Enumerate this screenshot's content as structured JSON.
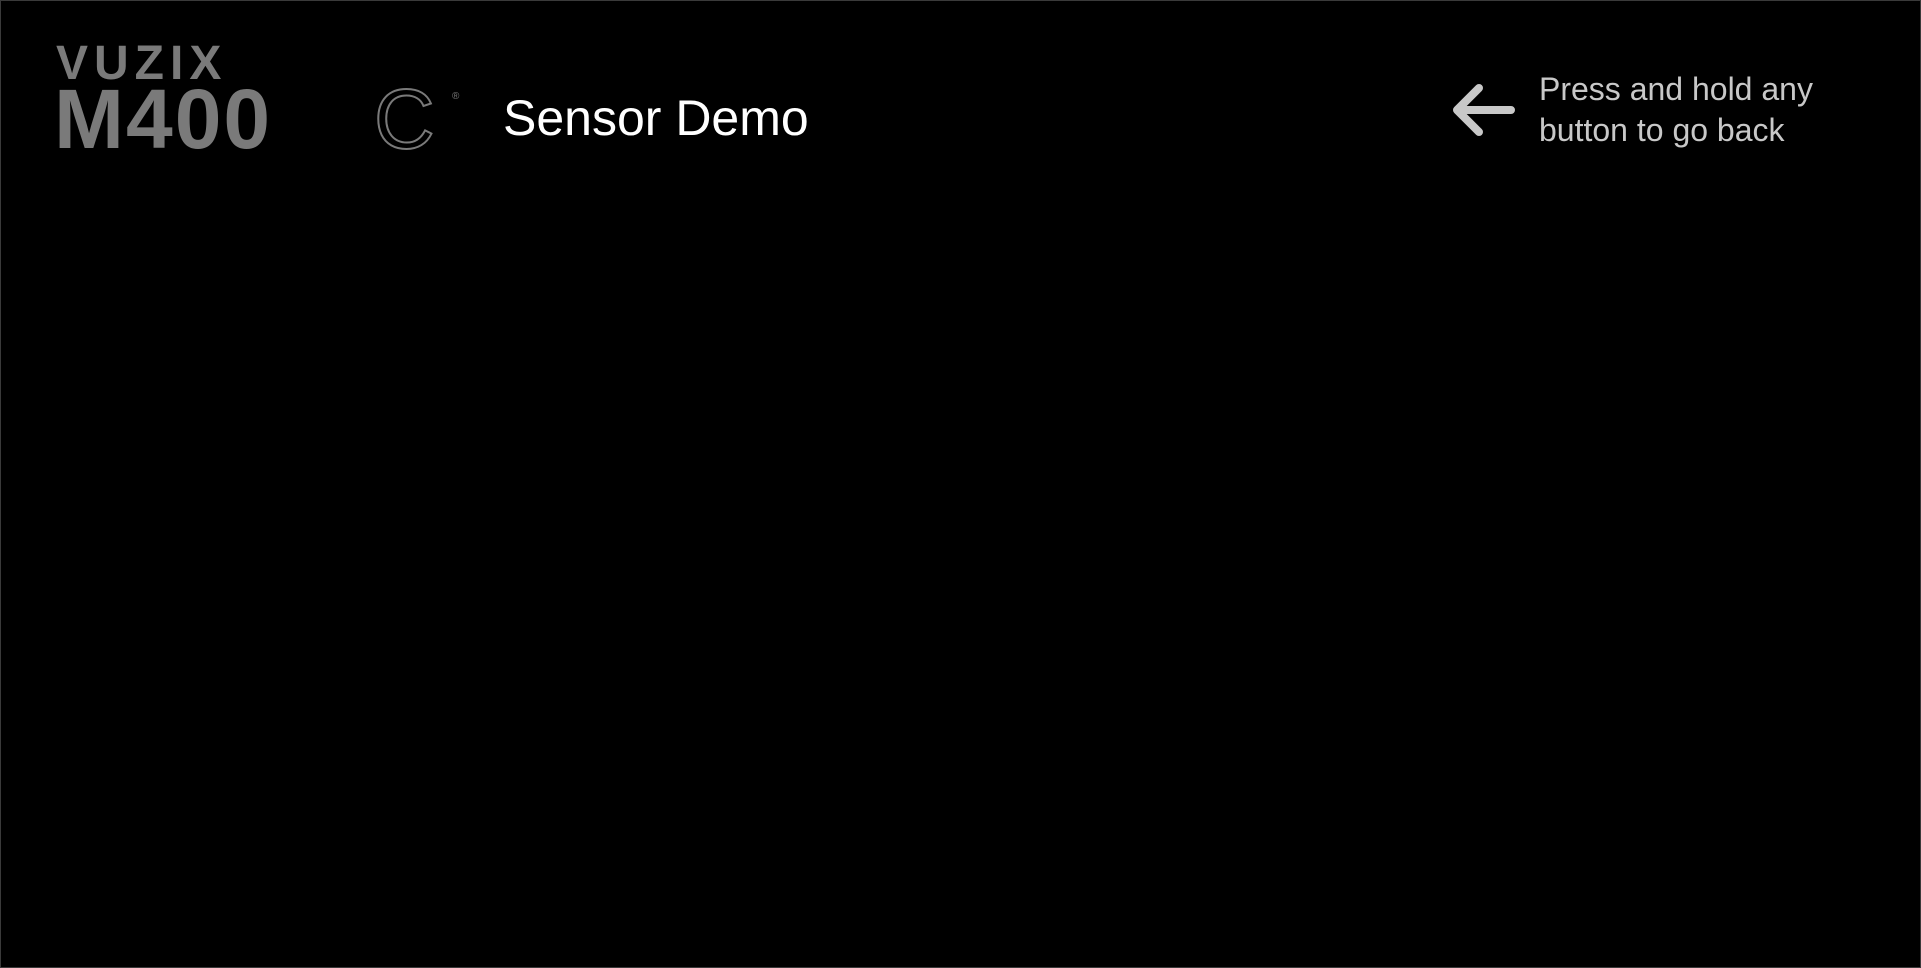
{
  "brand": {
    "line1": "VUZIX",
    "line2_bold": "M400",
    "line2_thin": "C",
    "mark": "®",
    "color": "#7a7a7a"
  },
  "header": {
    "title": "Sensor Demo"
  },
  "back_hint": {
    "icon": "arrow-left-icon",
    "text": "Press and hold any button to go back",
    "text_color": "#c8c8c8"
  },
  "colors": {
    "background": "#000000",
    "title": "#ffffff"
  }
}
